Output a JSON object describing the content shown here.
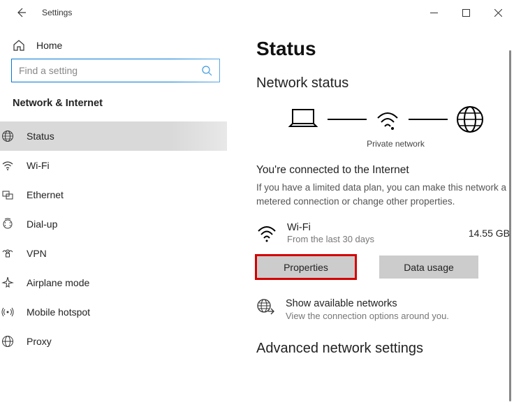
{
  "window": {
    "title": "Settings"
  },
  "sidebar": {
    "home": "Home",
    "search_placeholder": "Find a setting",
    "section": "Network & Internet",
    "items": [
      {
        "label": "Status"
      },
      {
        "label": "Wi-Fi"
      },
      {
        "label": "Ethernet"
      },
      {
        "label": "Dial-up"
      },
      {
        "label": "VPN"
      },
      {
        "label": "Airplane mode"
      },
      {
        "label": "Mobile hotspot"
      },
      {
        "label": "Proxy"
      }
    ]
  },
  "content": {
    "page_title": "Status",
    "section_title": "Network status",
    "diagram_caption": "Private network",
    "connected_heading": "You're connected to the Internet",
    "connected_desc": "If you have a limited data plan, you can make this network a metered connection or change other properties.",
    "connection": {
      "name": "Wi-Fi",
      "sub": "From the last 30 days",
      "amount": "14.55 GB"
    },
    "properties_btn": "Properties",
    "data_usage_btn": "Data usage",
    "available": {
      "title": "Show available networks",
      "desc": "View the connection options around you."
    },
    "advanced_title": "Advanced network settings"
  }
}
